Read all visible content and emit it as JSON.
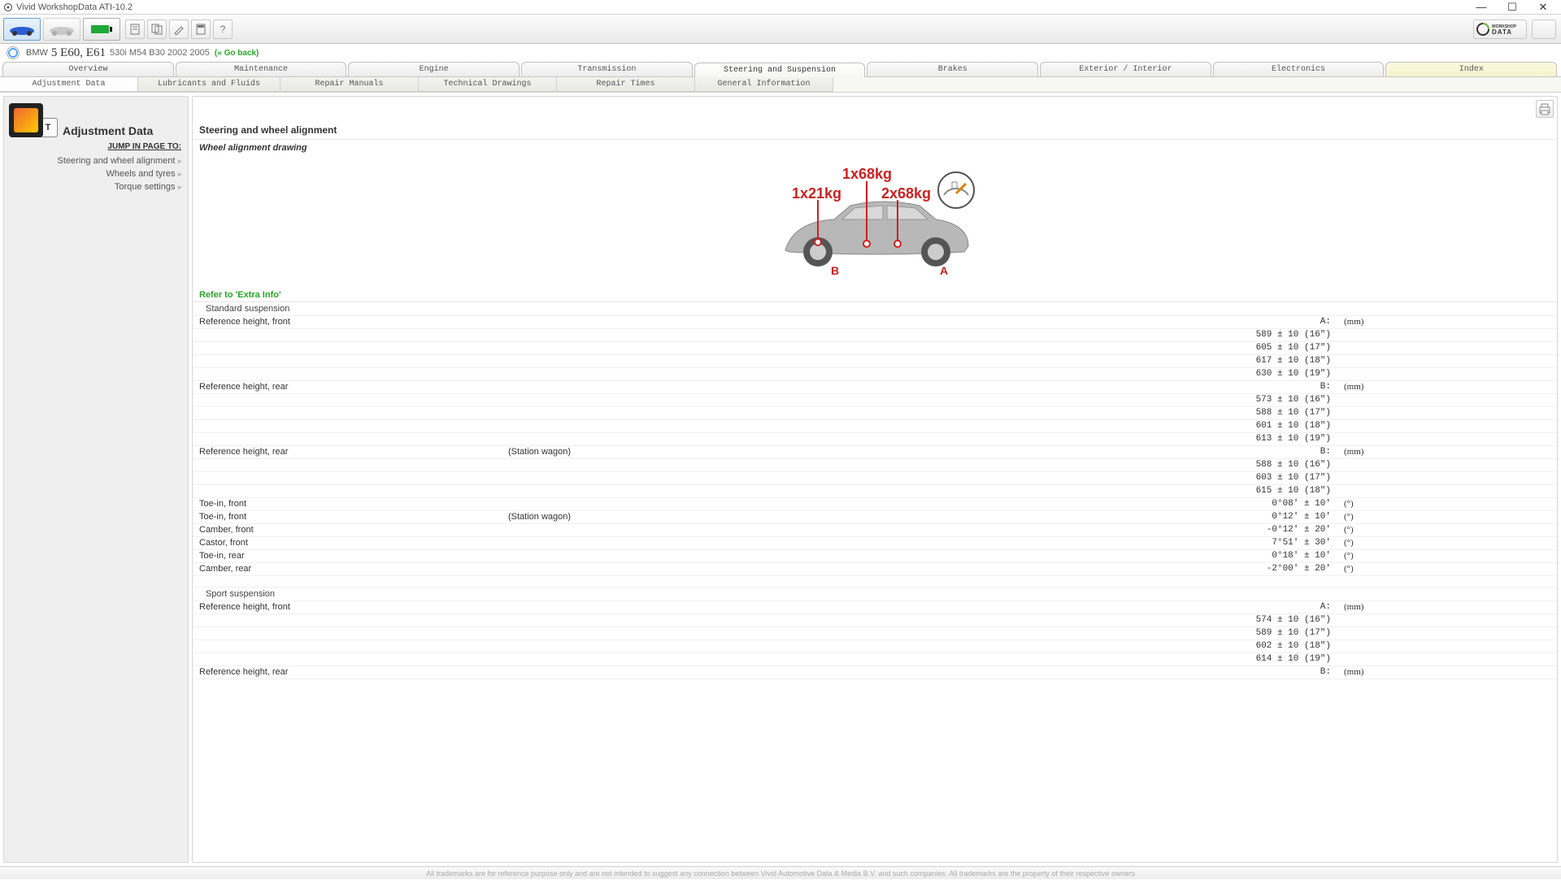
{
  "window": {
    "title": "Vivid WorkshopData ATI-10.2"
  },
  "vehicle": {
    "make_prefix": "BMW",
    "model": "5 E60, E61",
    "variant": "530i M54 B30 2002 2005",
    "goback": "(« Go back)"
  },
  "main_tabs": [
    "Overview",
    "Maintenance",
    "Engine",
    "Transmission",
    "Steering and Suspension",
    "Brakes",
    "Exterior / Interior",
    "Electronics",
    "Index"
  ],
  "main_tabs_active": 4,
  "sub_tabs": [
    "Adjustment Data",
    "Lubricants and Fluids",
    "Repair Manuals",
    "Technical Drawings",
    "Repair Times",
    "General Information"
  ],
  "sub_tabs_active": 0,
  "sidebar": {
    "title": "Adjustment Data",
    "jump_label": "JUMP IN PAGE TO:",
    "links": [
      "Steering and wheel alignment",
      "Wheels and tyres",
      "Torque settings"
    ]
  },
  "content": {
    "heading": "Steering and wheel alignment",
    "subheading": "Wheel alignment drawing",
    "diagram": {
      "w1": "1x21kg",
      "w2": "1x68kg",
      "w3": "2x68kg",
      "axleA": "A",
      "axleB": "B"
    },
    "extra_info": "Refer to 'Extra Info'",
    "sections": [
      {
        "title": "Standard suspension",
        "rows": [
          {
            "label": "Reference height, front",
            "note": "",
            "marker": "A:",
            "unit": "(mm)",
            "values": [
              "589 ± 10 (16\")",
              "605 ± 10 (17\")",
              "617 ± 10 (18\")",
              "630 ± 10 (19\")"
            ]
          },
          {
            "label": "Reference height, rear",
            "note": "",
            "marker": "B:",
            "unit": "(mm)",
            "values": [
              "573 ± 10 (16\")",
              "588 ± 10 (17\")",
              "601 ± 10 (18\")",
              "613 ± 10 (19\")"
            ]
          },
          {
            "label": "Reference height, rear",
            "note": "(Station wagon)",
            "marker": "B:",
            "unit": "(mm)",
            "values": [
              "588 ± 10 (16\")",
              "603 ± 10 (17\")",
              "615 ± 10 (18\")"
            ]
          },
          {
            "label": "Toe-in, front",
            "note": "",
            "marker": "",
            "unit": "(°)",
            "values": [
              "0°08' ± 10'"
            ]
          },
          {
            "label": "Toe-in, front",
            "note": "(Station wagon)",
            "marker": "",
            "unit": "(°)",
            "values": [
              "0°12' ± 10'"
            ]
          },
          {
            "label": "Camber, front",
            "note": "",
            "marker": "",
            "unit": "(°)",
            "values": [
              "-0°12' ± 20'"
            ]
          },
          {
            "label": "Castor, front",
            "note": "",
            "marker": "",
            "unit": "(°)",
            "values": [
              "7°51' ± 30'"
            ]
          },
          {
            "label": "Toe-in, rear",
            "note": "",
            "marker": "",
            "unit": "(°)",
            "values": [
              "0°18' ± 10'"
            ]
          },
          {
            "label": "Camber, rear",
            "note": "",
            "marker": "",
            "unit": "(°)",
            "values": [
              "-2°00' ± 20'"
            ]
          }
        ]
      },
      {
        "title": "Sport suspension",
        "rows": [
          {
            "label": "Reference height, front",
            "note": "",
            "marker": "A:",
            "unit": "(mm)",
            "values": [
              "574 ± 10 (16\")",
              "589 ± 10 (17\")",
              "602 ± 10 (18\")",
              "614 ± 10 (19\")"
            ]
          },
          {
            "label": "Reference height, rear",
            "note": "",
            "marker": "B:",
            "unit": "(mm)",
            "values": []
          }
        ]
      }
    ]
  },
  "footer": "All trademarks are for reference purpose only and are not intended to suggest any connection between Vivid Automotive Data & Media B.V. and such companies. All trademarks are the property of their respective owners"
}
